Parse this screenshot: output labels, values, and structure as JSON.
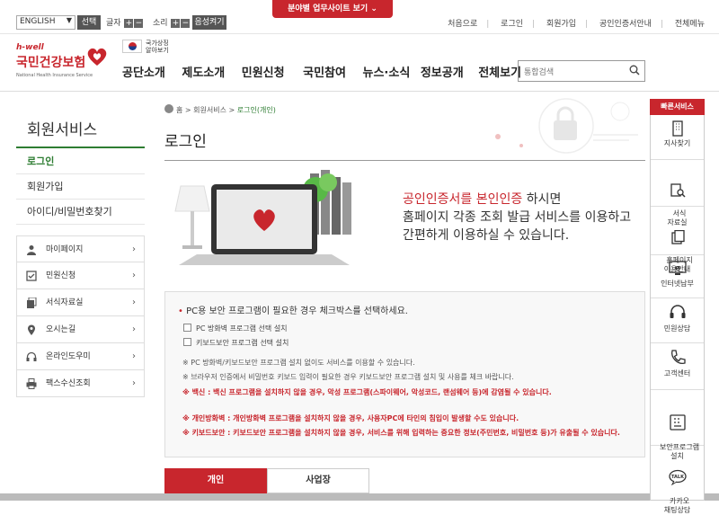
{
  "topbar": {
    "language": "ENGLISH",
    "select": "선택",
    "font_size": "글자",
    "sound": "소리",
    "listen": "음성켜기",
    "dropdown": "분야별 업무사이트 보기",
    "links": [
      "처음으로",
      "로그인",
      "회원가입",
      "공인인증서안내",
      "전체메뉴"
    ]
  },
  "header": {
    "logo_hwell": "h-well",
    "logo_name": "국민건강보험",
    "logo_sub": "National Health Insurance Service",
    "symbol_text": "국가상징\n알아보기",
    "nav": [
      "공단소개",
      "제도소개",
      "민원신청",
      "국민참여",
      "뉴스·소식",
      "정보공개",
      "전체보기"
    ],
    "search_placeholder": "통합검색"
  },
  "lnb": {
    "title": "회원서비스",
    "items": [
      "로그인",
      "회원가입",
      "아이디/비밀번호찾기"
    ],
    "services": [
      "마이페이지",
      "민원신청",
      "서식자료실",
      "오시는길",
      "온라인도우미",
      "팩스수신조회"
    ]
  },
  "main": {
    "breadcrumb": [
      "홈",
      "회원서비스",
      "로그인(개인)"
    ],
    "title": "로그인",
    "hero_red": "공인인증서를 본인인증",
    "hero_rest1": " 하시면",
    "hero_line2": "홈페이지 각종 조회 발급 서비스를 이용하고",
    "hero_line3": "간편하게 이용하실 수 있습니다.",
    "notice_title": "PC용 보안 프로그램이 필요한 경우 체크박스를 선택하세요.",
    "checkboxes": [
      "PC 방화벽 프로그램 선택 설치",
      "키보드보안 프로그램 선택 설치"
    ],
    "notes": [
      "※ PC 방화벽/키보드보안 프로그램 설치 없이도 서비스를 이용할 수 있습니다.",
      "※ 브라우저 인증에서 비밀번호 키보드 입력이 필요한 경우 키보드보안 프로그램 설치 및 사용를 체크 바랍니다."
    ],
    "warnings": [
      "※ 백신 : 백신 프로그램을 설치하지 않을 경우, 악성 프로그램(스파이웨어, 악성코드, 랜섬웨어 등)에 감염될 수 있습니다.",
      "※ 개인방화벽 : 개인방화벽 프로그램을 설치하지 않을 경우, 사용자PC에 타인의 침입이 발생할 수도 있습니다.",
      "※ 키보드보안 : 키보드보안 프로그램을 설치하지 않을 경우, 서비스를 위해 입력하는 중요한 정보(주민번호, 비밀번호 등)가 유출될 수 있습니다."
    ],
    "tabs": [
      "개인",
      "사업장"
    ]
  },
  "quick": {
    "title": "빠른서비스",
    "items": [
      "지사찾기",
      "서식\n자료실",
      "홈페이지\n이용안내",
      "인터넷납부",
      "민원상담",
      "고객센터",
      "보안프로그램\n설치",
      "카카오\n채팅상담"
    ]
  },
  "colors": {
    "accent": "#c8262d",
    "green": "#2e7d32"
  }
}
